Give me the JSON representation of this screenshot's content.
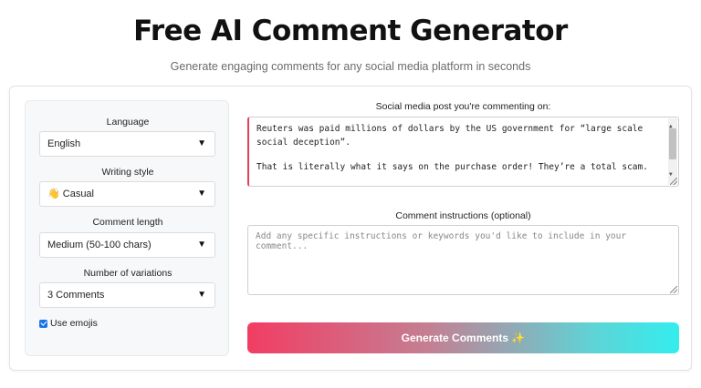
{
  "header": {
    "title": "Free AI Comment Generator",
    "subtitle": "Generate engaging comments for any social media platform in seconds"
  },
  "settings": {
    "language": {
      "label": "Language",
      "value": "English"
    },
    "writing_style": {
      "label": "Writing style",
      "value": "👋 Casual"
    },
    "comment_length": {
      "label": "Comment length",
      "value": "Medium (50-100 chars)"
    },
    "variations": {
      "label": "Number of variations",
      "value": "3 Comments"
    },
    "use_emojis": {
      "label": "Use emojis",
      "checked": true
    }
  },
  "post": {
    "label": "Social media post you're commenting on:",
    "paragraph_1": "Reuters was paid millions of dollars by the US government for “large scale social deception”.",
    "paragraph_2": "That is literally what it says on the purchase order! They’re a total scam."
  },
  "instructions": {
    "label": "Comment instructions (optional)",
    "placeholder": "Add any specific instructions or keywords you'd like to include in your comment..."
  },
  "generate": {
    "label": "Generate Comments ✨"
  },
  "colors": {
    "accent_pink": "#f23d63",
    "accent_cyan": "#33eded",
    "checkbox_blue": "#1a73e8"
  }
}
